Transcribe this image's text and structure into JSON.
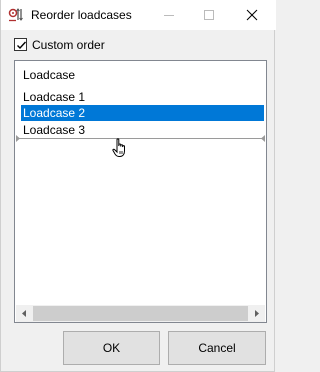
{
  "window": {
    "title": "Reorder loadcases"
  },
  "options": {
    "custom_order_label": "Custom order",
    "custom_order_checked": true
  },
  "list": {
    "header": "Loadcase",
    "items": [
      {
        "label": "Loadcase 1",
        "selected": false
      },
      {
        "label": "Loadcase 2",
        "selected": true
      },
      {
        "label": "Loadcase 3",
        "selected": false
      }
    ]
  },
  "buttons": {
    "ok_label": "OK",
    "cancel_label": "Cancel"
  },
  "colors": {
    "selection": "#0078d7",
    "dialog_bg": "#f0f0f0"
  },
  "icons": [
    "app-icon",
    "minimize-icon",
    "maximize-icon",
    "close-icon",
    "checkmark-icon",
    "hand-cursor-icon",
    "scroll-left-arrow-icon",
    "scroll-right-arrow-icon"
  ]
}
